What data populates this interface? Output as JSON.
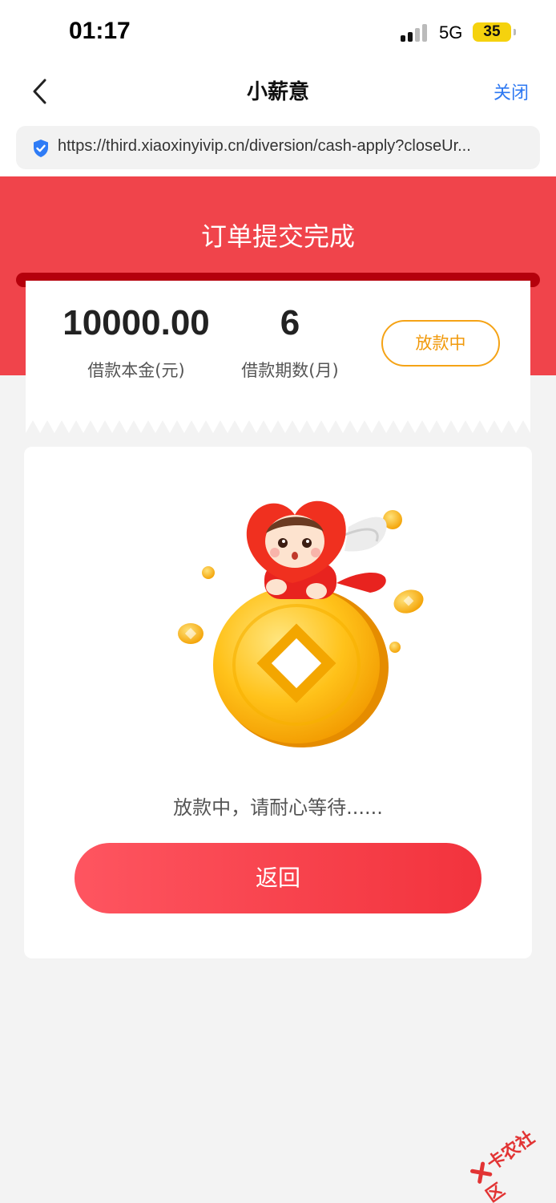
{
  "status_bar": {
    "time": "01:17",
    "network": "5G",
    "battery": "35"
  },
  "nav": {
    "title": "小薪意",
    "close_label": "关闭"
  },
  "url_bar": {
    "url": "https://third.xiaoxinyivip.cn/diversion/cash-apply?closeUr..."
  },
  "header": {
    "title": "订单提交完成",
    "background_color": "#f0444b"
  },
  "order": {
    "amount": "10000.00",
    "amount_label": "借款本金(元)",
    "term": "6",
    "term_label": "借款期数(月)",
    "status": "放款中"
  },
  "main": {
    "wait_text": "放款中，请耐心等待......",
    "return_label": "返回",
    "illustration_icon": "cupid-on-gold-coin"
  },
  "watermark": {
    "text": "卡农社区"
  },
  "colors": {
    "accent_red": "#f2333d",
    "status_orange": "#f19a0c",
    "link_blue": "#2d78f2"
  }
}
